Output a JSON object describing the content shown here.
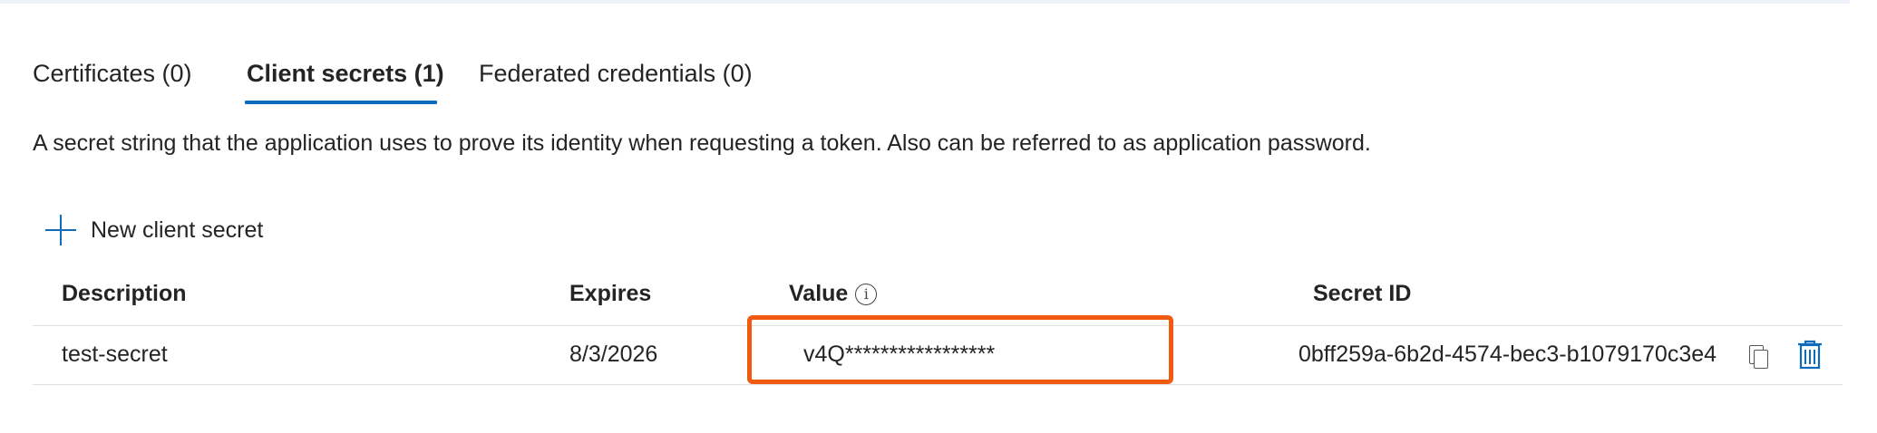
{
  "tabs": [
    {
      "label": "Certificates (0)"
    },
    {
      "label": "Client secrets (1)",
      "active": true
    },
    {
      "label": "Federated credentials (0)"
    }
  ],
  "description": "A secret string that the application uses to prove its identity when requesting a token. Also can be referred to as application password.",
  "toolbar": {
    "new_secret_label": "New client secret",
    "new_secret_icon": "plus-icon"
  },
  "table": {
    "headers": {
      "description": "Description",
      "expires": "Expires",
      "value": "Value",
      "value_info_icon": "info-icon",
      "secret_id": "Secret ID"
    },
    "rows": [
      {
        "description": "test-secret",
        "expires": "8/3/2026",
        "value": "v4Q*****************",
        "secret_id": "0bff259a-6b2d-4574-bec3-b1079170c3e4"
      }
    ]
  },
  "colors": {
    "accent": "#0f6cbd",
    "highlight_border": "#f15a11"
  }
}
